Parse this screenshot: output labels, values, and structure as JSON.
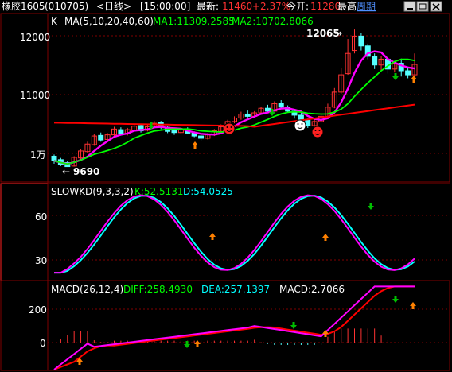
{
  "header": {
    "symbol": "橡胶1605",
    "code": "(010705)",
    "period": "<日线>",
    "time": "[15:00:00]",
    "latest_label": "最新:",
    "latest_value": "11460",
    "change_pct": "+2.37%",
    "open_label": "今开:",
    "open_value": "11280",
    "high_label": "最高",
    "period_link": "周期"
  },
  "window_controls": {
    "minimize_icon": "minimize-icon",
    "restore_icon": "restore-icon",
    "close_icon": "close-icon"
  },
  "colors": {
    "up": "#ff3232",
    "down": "#54ffff",
    "ma1": "#ff00ff",
    "ma2": "#00ff00",
    "ma3": "#ff0000",
    "k": "#ff00ff",
    "d": "#00ffff",
    "diff": "#ff00ff",
    "dea": "#ff0000",
    "grid": "#800000",
    "axis": "#ffffff"
  },
  "main_panel": {
    "title_k": "K",
    "title_ma": "MA(5,10,20,40,60)",
    "ma1_text": "MA1:11309.2585",
    "ma2_text": "MA2:10702.8066",
    "high_marker": "12065",
    "low_marker": "9690",
    "ticks": [
      "12000",
      "11000",
      "1万"
    ]
  },
  "kd_panel": {
    "title": "SLOWKD(9,3,3,2)",
    "k_text": "K:52.5131",
    "d_text": "D:54.0525",
    "ticks": [
      "60",
      "30"
    ]
  },
  "macd_panel": {
    "title": "MACD(26,12,4)",
    "diff_text": "DIFF:258.4930",
    "dea_text": "DEA:257.1397",
    "macd_text": "MACD:2.7066",
    "ticks": [
      "200",
      "0"
    ]
  },
  "chart_data": {
    "type": "candlestick",
    "price_range": [
      9450,
      12300
    ],
    "price_ticks": [
      12000,
      11000,
      10000
    ],
    "candles": [
      [
        9870,
        9790,
        9900,
        9740
      ],
      [
        9810,
        9730,
        9840,
        9700
      ],
      [
        9760,
        9690,
        9790,
        9690
      ],
      [
        9700,
        9850,
        9870,
        9690
      ],
      [
        9840,
        9960,
        9990,
        9800
      ],
      [
        9950,
        10080,
        10120,
        9920
      ],
      [
        10070,
        10220,
        10260,
        10050
      ],
      [
        10230,
        10150,
        10280,
        10120
      ],
      [
        10160,
        10240,
        10270,
        10130
      ],
      [
        10240,
        10340,
        10380,
        10210
      ],
      [
        10330,
        10260,
        10370,
        10230
      ],
      [
        10260,
        10330,
        10360,
        10230
      ],
      [
        10320,
        10390,
        10420,
        10300
      ],
      [
        10400,
        10310,
        10420,
        10280
      ],
      [
        10320,
        10380,
        10410,
        10300
      ],
      [
        10380,
        10440,
        10480,
        10350
      ],
      [
        10450,
        10370,
        10480,
        10340
      ],
      [
        10370,
        10300,
        10400,
        10270
      ],
      [
        10310,
        10280,
        10340,
        10240
      ],
      [
        10280,
        10340,
        10360,
        10250
      ],
      [
        10340,
        10270,
        10370,
        10250
      ],
      [
        10270,
        10220,
        10300,
        10200
      ],
      [
        10220,
        10180,
        10260,
        10140
      ],
      [
        10180,
        10240,
        10270,
        10160
      ],
      [
        10240,
        10310,
        10340,
        10220
      ],
      [
        10300,
        10380,
        10420,
        10290
      ],
      [
        10380,
        10470,
        10500,
        10360
      ],
      [
        10470,
        10530,
        10560,
        10440
      ],
      [
        10530,
        10600,
        10640,
        10500
      ],
      [
        10600,
        10560,
        10660,
        10540
      ],
      [
        10560,
        10620,
        10650,
        10540
      ],
      [
        10620,
        10700,
        10730,
        10600
      ],
      [
        10700,
        10650,
        10760,
        10630
      ],
      [
        10650,
        10780,
        10820,
        10640
      ],
      [
        10780,
        10720,
        10840,
        10700
      ],
      [
        10720,
        10650,
        10750,
        10620
      ],
      [
        10650,
        10580,
        10680,
        10520
      ],
      [
        10580,
        10480,
        10620,
        10440
      ],
      [
        10490,
        10400,
        10520,
        10360
      ],
      [
        10400,
        10470,
        10510,
        10380
      ],
      [
        10470,
        10560,
        10600,
        10450
      ],
      [
        10560,
        10720,
        10780,
        10540
      ],
      [
        10720,
        10980,
        11050,
        10700
      ],
      [
        10980,
        11280,
        11400,
        10950
      ],
      [
        11300,
        11650,
        11900,
        11280
      ],
      [
        11700,
        11950,
        12065,
        11650
      ],
      [
        11950,
        11780,
        12000,
        11700
      ],
      [
        11780,
        11600,
        11820,
        11550
      ],
      [
        11600,
        11450,
        11650,
        11380
      ],
      [
        11450,
        11550,
        11600,
        11350
      ],
      [
        11550,
        11380,
        11600,
        11300
      ],
      [
        11380,
        11480,
        11520,
        11320
      ],
      [
        11480,
        11350,
        11560,
        11250
      ],
      [
        11350,
        11280,
        11400,
        11220
      ],
      [
        11280,
        11460,
        11650,
        11250
      ]
    ],
    "ma_series": [
      {
        "name": "MA1",
        "last": 11309.2585
      },
      {
        "name": "MA2",
        "last": 10702.8066
      }
    ],
    "kd": {
      "k_last": 52.5131,
      "d_last": 54.0525,
      "ticks": [
        60,
        30
      ]
    },
    "macd": {
      "diff_last": 258.493,
      "dea_last": 257.1397,
      "macd_last": 2.7066,
      "ticks": [
        200,
        0
      ]
    },
    "markers": {
      "high_value": 12065,
      "low_value": 9690
    },
    "grid": true
  }
}
